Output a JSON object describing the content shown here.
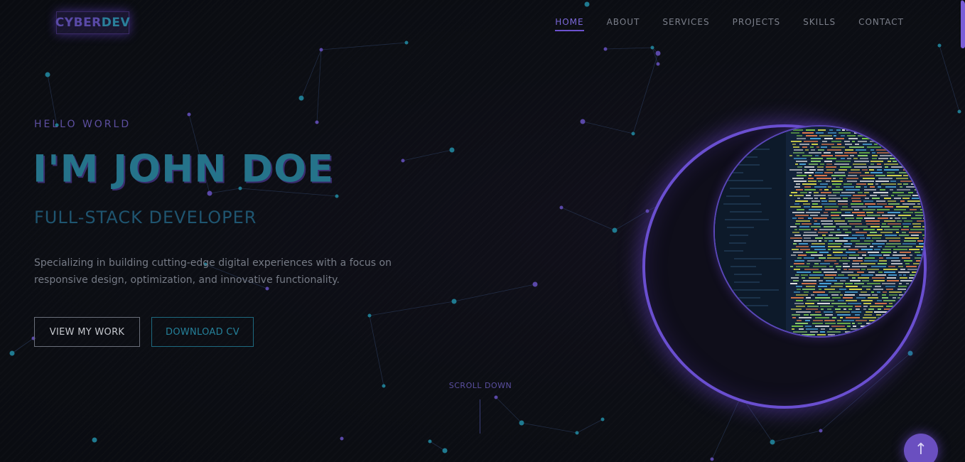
{
  "header": {
    "logo_part1": "CYBER",
    "logo_part2": "DEV",
    "nav": [
      "HOME",
      "ABOUT",
      "SERVICES",
      "PROJECTS",
      "SKILLS",
      "CONTACT"
    ],
    "active_nav": "HOME"
  },
  "hero": {
    "greeting": "HELLO WORLD",
    "title": "I'M JOHN DOE",
    "subtitle": "FULL-STACK DEVELOPER",
    "description": "Specializing in building cutting-edge digital experiences with a focus on responsive design, optimization, and innovative functionality.",
    "primary_button": "VIEW MY WORK",
    "secondary_button": "DOWNLOAD CV",
    "scroll_hint": "SCROLL DOWN"
  },
  "back_to_top_icon": "arrow-up-icon",
  "colors": {
    "purple_accent": "#6c52cf",
    "teal_accent": "#25819a",
    "background": "#0b0d12"
  }
}
